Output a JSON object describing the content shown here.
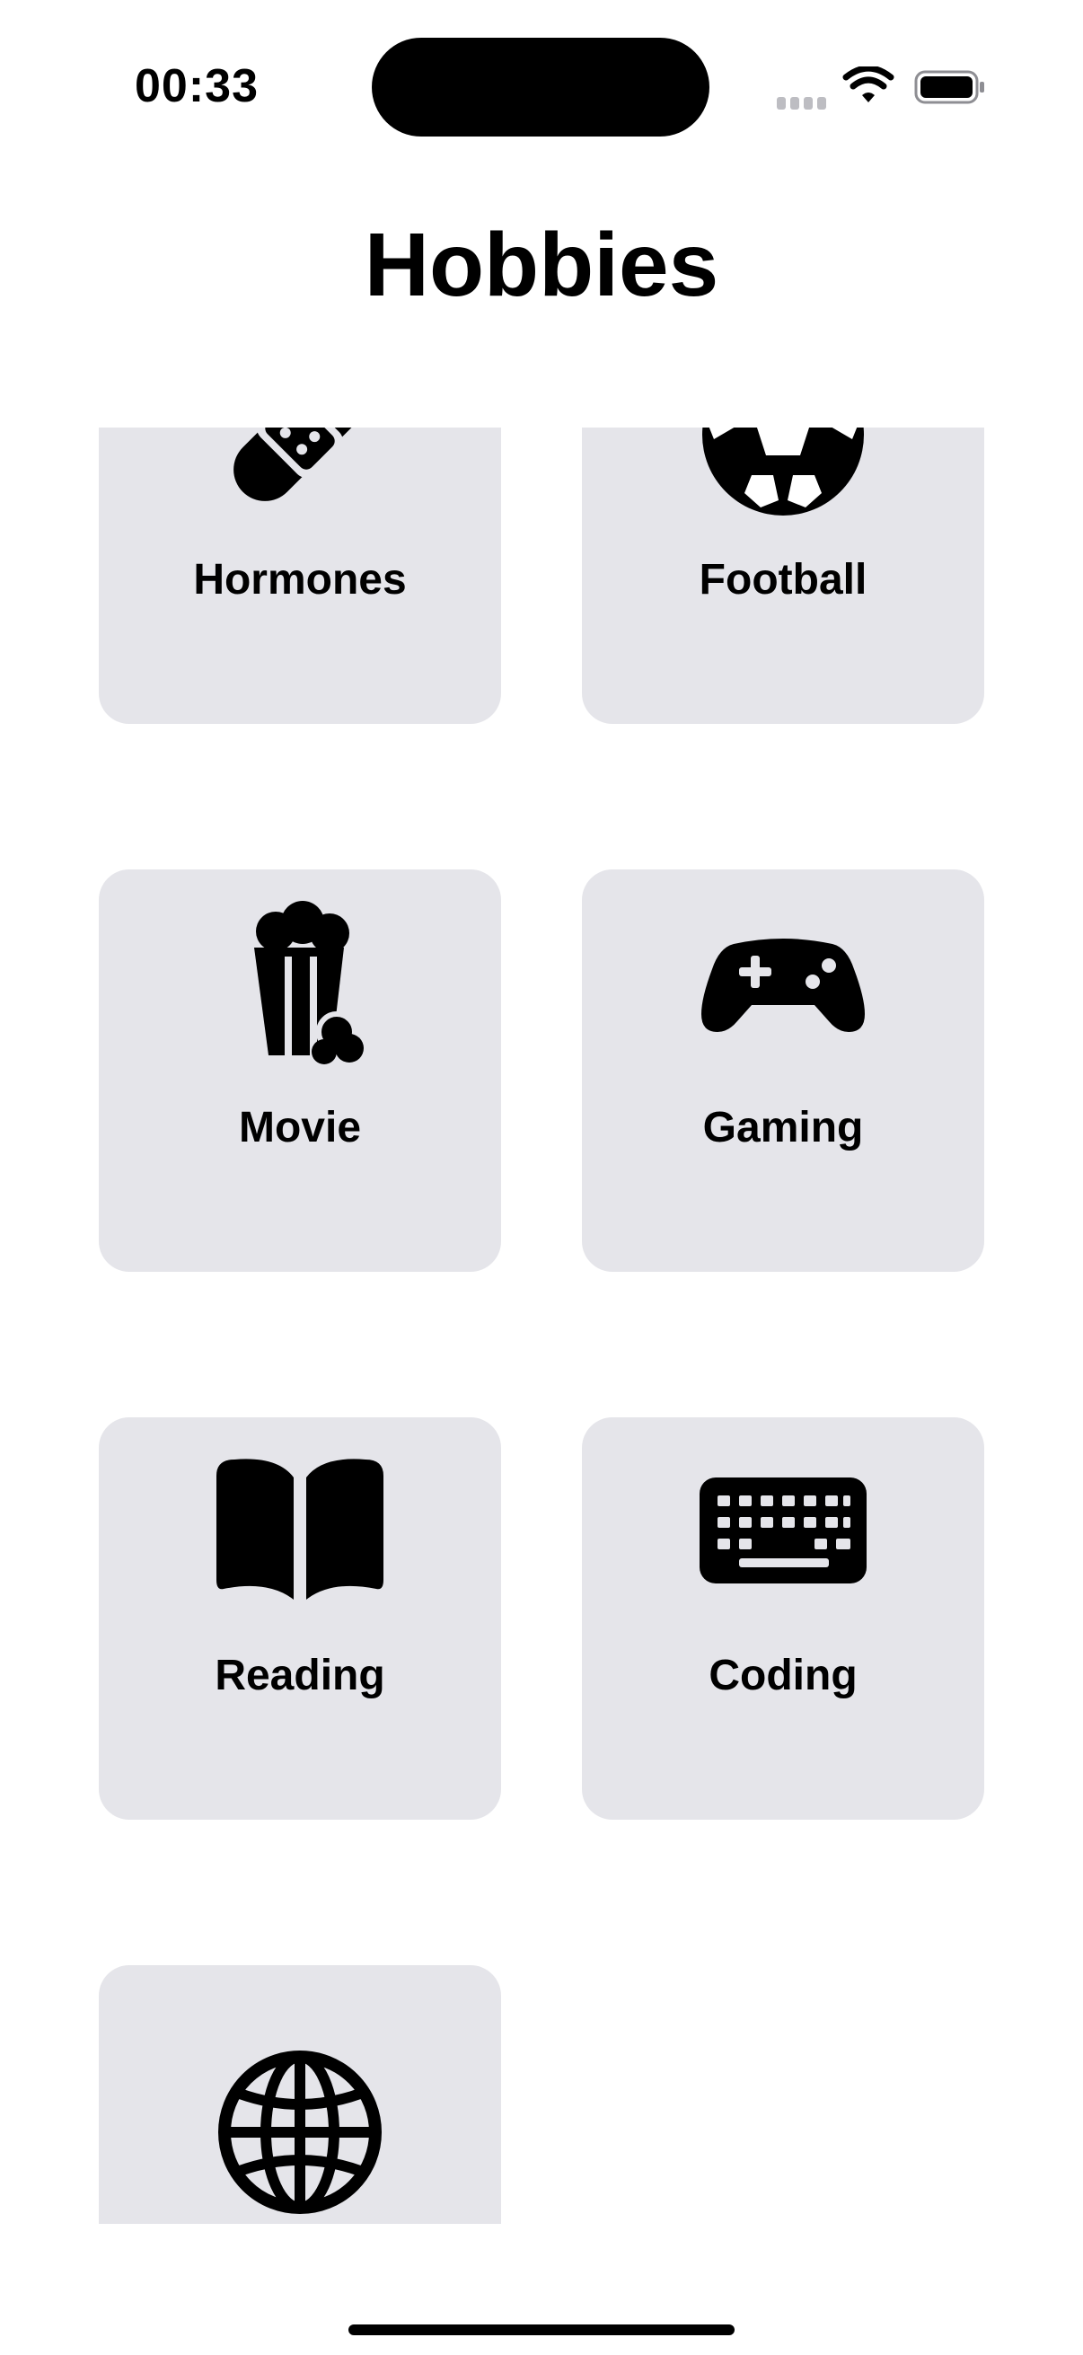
{
  "status_bar": {
    "time": "00:33"
  },
  "page": {
    "title": "Hobbies"
  },
  "hobbies": [
    {
      "label": "Hormones",
      "icon": "bandage-icon"
    },
    {
      "label": "Football",
      "icon": "soccer-ball-icon"
    },
    {
      "label": "Movie",
      "icon": "popcorn-icon"
    },
    {
      "label": "Gaming",
      "icon": "gamecontroller-icon"
    },
    {
      "label": "Reading",
      "icon": "book-icon"
    },
    {
      "label": "Coding",
      "icon": "keyboard-icon"
    },
    {
      "label": "",
      "icon": "globe-icon"
    }
  ],
  "colors": {
    "card_background": "#e5e5ea",
    "text": "#000000",
    "background": "#ffffff"
  }
}
